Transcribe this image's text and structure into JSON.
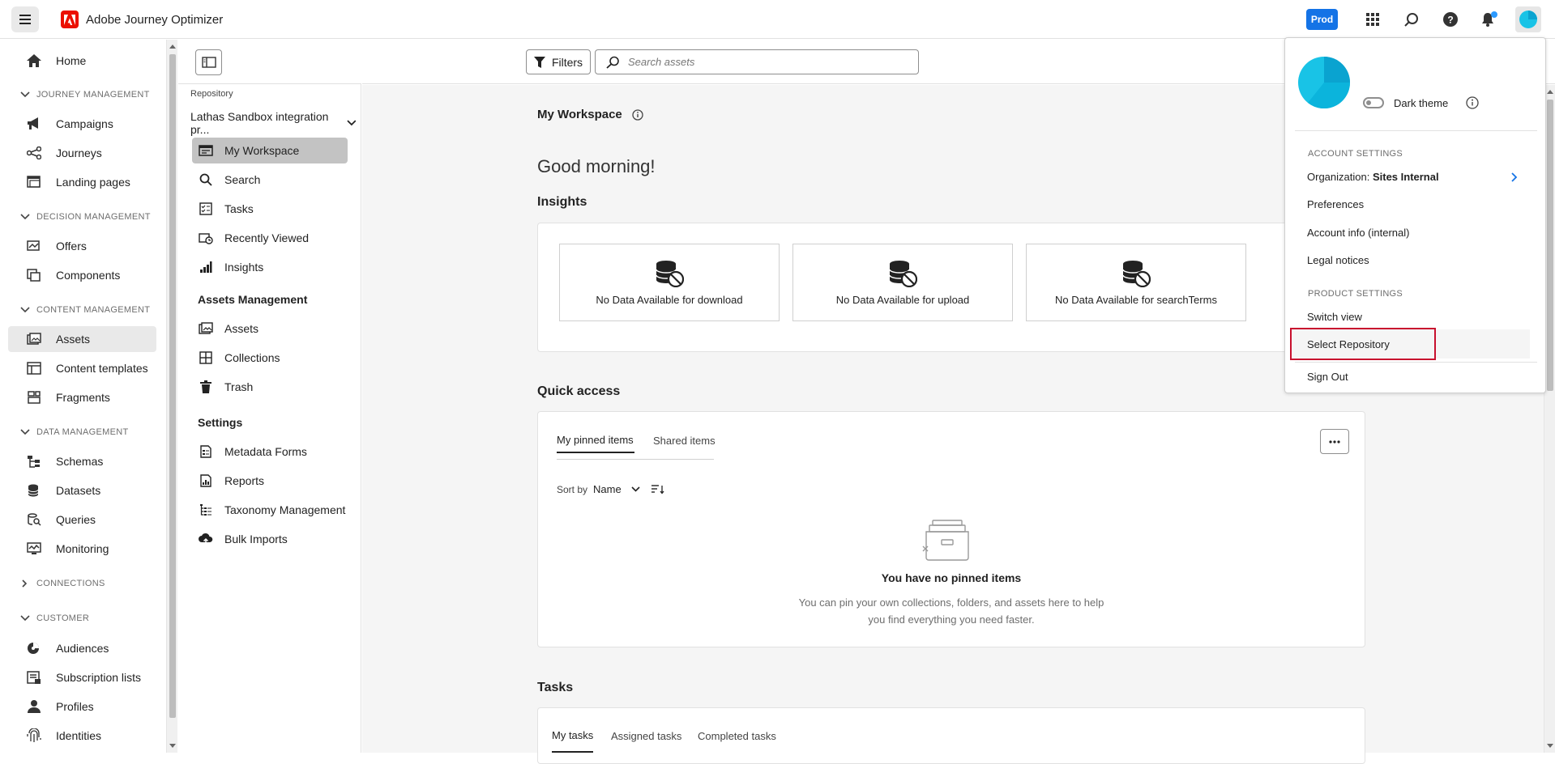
{
  "header": {
    "app_title": "Adobe Journey Optimizer",
    "env_badge": "Prod",
    "icons": [
      "menu-icon",
      "adobe-logo-icon",
      "apps-grid-icon",
      "search-icon",
      "help-icon",
      "notification-bell-icon",
      "user-avatar-icon"
    ]
  },
  "nav": {
    "home": "Home",
    "journey_management": {
      "label": "JOURNEY MANAGEMENT",
      "items": [
        "Campaigns",
        "Journeys",
        "Landing pages"
      ]
    },
    "decision_management": {
      "label": "DECISION MANAGEMENT",
      "items": [
        "Offers",
        "Components"
      ]
    },
    "content_management": {
      "label": "CONTENT MANAGEMENT",
      "items": [
        "Assets",
        "Content templates",
        "Fragments"
      ]
    },
    "data_management": {
      "label": "DATA MANAGEMENT",
      "items": [
        "Schemas",
        "Datasets",
        "Queries",
        "Monitoring"
      ]
    },
    "connections": {
      "label": "CONNECTIONS"
    },
    "customer": {
      "label": "CUSTOMER",
      "items": [
        "Audiences",
        "Subscription lists",
        "Profiles",
        "Identities"
      ]
    },
    "selected": "Assets"
  },
  "panel": {
    "repository_label": "Repository",
    "repository_value": "Lathas Sandbox integration pr...",
    "items": [
      "My Workspace",
      "Search",
      "Tasks",
      "Recently Viewed",
      "Insights"
    ],
    "assets_management": {
      "label": "Assets Management",
      "items": [
        "Assets",
        "Collections",
        "Trash"
      ]
    },
    "settings": {
      "label": "Settings",
      "items": [
        "Metadata Forms",
        "Reports",
        "Taxonomy Management",
        "Bulk Imports"
      ]
    },
    "selected": "My Workspace"
  },
  "toolbar": {
    "filters_label": "Filters",
    "search_placeholder": "Search assets"
  },
  "main": {
    "workspace_title": "My Workspace",
    "greeting": "Good morning!",
    "insights_title": "Insights",
    "insights_cards": [
      "No Data Available for download",
      "No Data Available for upload",
      "No Data Available for searchTerms"
    ],
    "quick_access_title": "Quick access",
    "quick_tabs": [
      "My pinned items",
      "Shared items"
    ],
    "sort_by_label": "Sort by",
    "sort_by_value": "Name",
    "empty_title": "You have no pinned items",
    "empty_desc": "You can pin your own collections, folders, and assets here to help you find everything you need faster.",
    "tasks_title": "Tasks",
    "task_tabs": [
      "My tasks",
      "Assigned tasks",
      "Completed tasks"
    ]
  },
  "user_menu": {
    "dark_theme_label": "Dark theme",
    "dark_theme_on": false,
    "account_settings_label": "ACCOUNT SETTINGS",
    "organization_prefix": "Organization:",
    "organization_name": "Sites Internal",
    "preferences": "Preferences",
    "account_info": "Account info (internal)",
    "legal_notices": "Legal notices",
    "product_settings_label": "PRODUCT SETTINGS",
    "switch_view": "Switch view",
    "select_repository": "Select Repository",
    "sign_out": "Sign Out"
  },
  "colors": {
    "accent": "#1473e6",
    "adobe_red": "#eb1000",
    "avatar_cyan": "#19c3e6",
    "highlight_border": "#c8102e"
  }
}
